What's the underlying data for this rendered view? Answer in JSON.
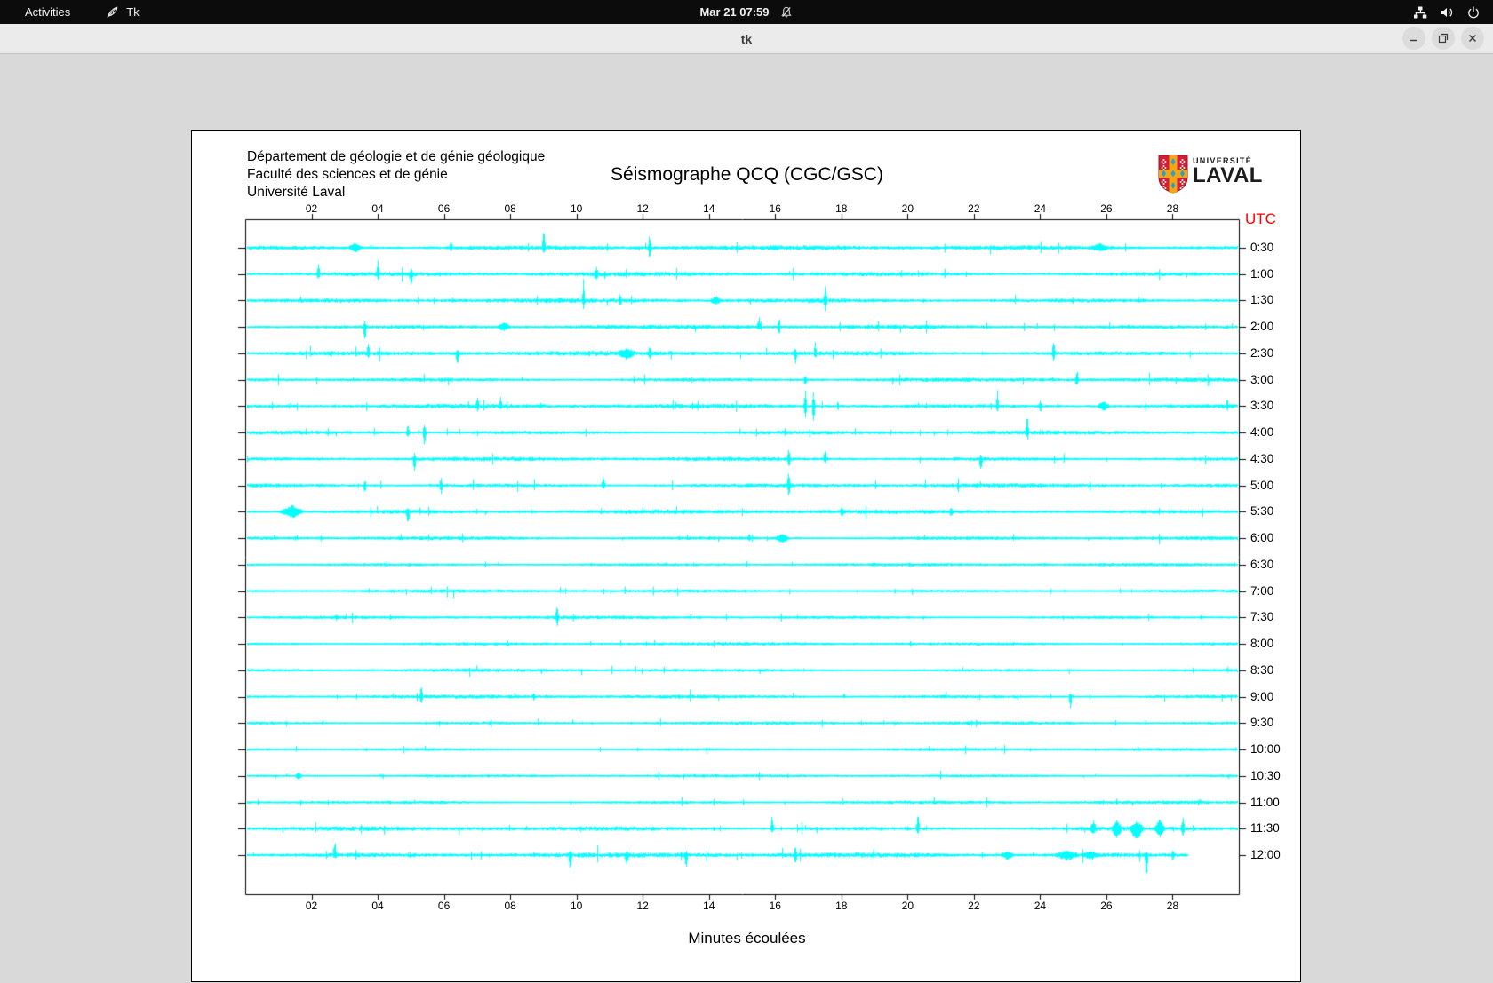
{
  "top_bar": {
    "activities_label": "Activities",
    "app_name": "Tk",
    "clock": "Mar 21 07:59"
  },
  "window": {
    "title": "tk"
  },
  "header": {
    "lines": [
      "Département de géologie et de génie géologique",
      "Faculté des sciences et de génie",
      "Université Laval"
    ],
    "title": "Séismographe QCQ (CGC/GSC)"
  },
  "logo": {
    "small_text": "UNIVERSITÉ",
    "big_text": "LAVAL"
  },
  "plot": {
    "utc_label": "UTC",
    "xlabel": "Minutes écoulées"
  },
  "chart_data": {
    "type": "line",
    "title": "Séismographe QCQ (CGC/GSC)",
    "xlabel": "Minutes écoulées",
    "ylabel_right": "UTC",
    "x_range_minutes": [
      0,
      30
    ],
    "x_ticks": [
      "02",
      "04",
      "06",
      "08",
      "10",
      "12",
      "14",
      "16",
      "18",
      "20",
      "22",
      "24",
      "26",
      "28"
    ],
    "trace_color": "#00ffff",
    "utc_color": "#ff0000",
    "grid": false,
    "traces": [
      {
        "label": "0:30",
        "noise": 1.4,
        "end": 30,
        "events": [
          [
            3.3,
            5,
            5,
            4
          ],
          [
            6.2,
            7,
            4,
            1
          ],
          [
            9.0,
            21,
            5,
            1
          ],
          [
            12.2,
            17,
            15,
            1
          ],
          [
            25.8,
            4,
            4,
            5
          ]
        ]
      },
      {
        "label": "1:00",
        "noise": 1.3,
        "end": 30,
        "events": [
          [
            2.2,
            13,
            5,
            1
          ],
          [
            4.0,
            15,
            8,
            1
          ],
          [
            5.0,
            6,
            17,
            1
          ],
          [
            10.6,
            7,
            6,
            1
          ]
        ]
      },
      {
        "label": "1:30",
        "noise": 1.3,
        "end": 30,
        "events": [
          [
            10.2,
            19,
            5,
            1
          ],
          [
            11.3,
            7,
            5,
            1
          ],
          [
            14.2,
            4,
            4,
            3
          ],
          [
            17.5,
            17,
            13,
            1
          ]
        ]
      },
      {
        "label": "2:00",
        "noise": 1.3,
        "end": 30,
        "events": [
          [
            3.6,
            6,
            22,
            1
          ],
          [
            7.8,
            5,
            4,
            4
          ],
          [
            15.5,
            12,
            4,
            1
          ],
          [
            16.1,
            8,
            6,
            1
          ]
        ]
      },
      {
        "label": "2:30",
        "noise": 1.4,
        "end": 30,
        "events": [
          [
            3.7,
            14,
            4,
            1
          ],
          [
            6.4,
            4,
            21,
            1
          ],
          [
            11.5,
            5,
            5,
            5
          ],
          [
            12.2,
            8,
            6,
            1
          ],
          [
            16.6,
            5,
            14,
            1
          ],
          [
            17.2,
            12,
            5,
            1
          ],
          [
            24.4,
            19,
            9,
            1
          ]
        ]
      },
      {
        "label": "3:00",
        "noise": 1.2,
        "end": 30,
        "events": [
          [
            16.9,
            6,
            6,
            1
          ],
          [
            25.1,
            13,
            10,
            1
          ]
        ]
      },
      {
        "label": "3:30",
        "noise": 1.3,
        "end": 30,
        "events": [
          [
            7.0,
            13,
            5,
            1
          ],
          [
            7.7,
            10,
            4,
            1
          ],
          [
            16.9,
            20,
            18,
            1
          ],
          [
            17.15,
            16,
            20,
            1
          ],
          [
            22.7,
            17,
            6,
            1
          ],
          [
            24.0,
            6,
            6,
            1
          ],
          [
            25.9,
            5,
            5,
            4
          ]
        ]
      },
      {
        "label": "4:00",
        "noise": 1.2,
        "end": 30,
        "events": [
          [
            4.9,
            9,
            6,
            1
          ],
          [
            5.4,
            15,
            16,
            1
          ],
          [
            23.6,
            21,
            6,
            1
          ]
        ]
      },
      {
        "label": "4:30",
        "noise": 1.2,
        "end": 30,
        "events": [
          [
            5.1,
            5,
            16,
            1
          ],
          [
            16.4,
            10,
            12,
            1
          ],
          [
            17.5,
            13,
            4,
            1
          ],
          [
            22.2,
            5,
            21,
            1
          ]
        ]
      },
      {
        "label": "5:00",
        "noise": 1.2,
        "end": 30,
        "events": [
          [
            3.6,
            5,
            12,
            1
          ],
          [
            5.9,
            10,
            10,
            1
          ],
          [
            10.8,
            13,
            4,
            1
          ],
          [
            16.4,
            15,
            16,
            1
          ]
        ]
      },
      {
        "label": "5:30",
        "noise": 1.3,
        "end": 30,
        "events": [
          [
            1.4,
            7,
            7,
            7
          ],
          [
            4.9,
            4,
            21,
            1
          ],
          [
            18.0,
            6,
            5,
            1
          ],
          [
            21.3,
            4,
            4,
            1
          ]
        ]
      },
      {
        "label": "6:00",
        "noise": 1.1,
        "end": 30,
        "events": [
          [
            15.2,
            5,
            4,
            1
          ],
          [
            16.2,
            5,
            5,
            4
          ]
        ]
      },
      {
        "label": "6:30",
        "noise": 1.0,
        "end": 30,
        "events": []
      },
      {
        "label": "7:00",
        "noise": 1.0,
        "end": 30,
        "events": []
      },
      {
        "label": "7:30",
        "noise": 1.0,
        "end": 30,
        "events": [
          [
            9.4,
            15,
            12,
            1
          ]
        ]
      },
      {
        "label": "8:00",
        "noise": 1.0,
        "end": 30,
        "events": []
      },
      {
        "label": "8:30",
        "noise": 1.0,
        "end": 30,
        "events": []
      },
      {
        "label": "9:00",
        "noise": 1.1,
        "end": 30,
        "events": [
          [
            5.3,
            13,
            10,
            1
          ],
          [
            8.7,
            5,
            4,
            1
          ],
          [
            24.9,
            4,
            18,
            1
          ]
        ]
      },
      {
        "label": "9:30",
        "noise": 1.0,
        "end": 30,
        "events": []
      },
      {
        "label": "10:00",
        "noise": 0.9,
        "end": 30,
        "events": []
      },
      {
        "label": "10:30",
        "noise": 0.9,
        "end": 30,
        "events": [
          [
            1.6,
            4,
            4,
            2
          ]
        ]
      },
      {
        "label": "11:00",
        "noise": 1.0,
        "end": 30,
        "events": []
      },
      {
        "label": "11:30",
        "noise": 1.3,
        "end": 30,
        "events": [
          [
            15.9,
            17,
            5,
            1
          ],
          [
            20.3,
            19,
            6,
            1
          ],
          [
            25.6,
            8,
            6,
            2
          ],
          [
            26.3,
            10,
            12,
            3
          ],
          [
            26.9,
            8,
            14,
            4
          ],
          [
            27.6,
            12,
            10,
            3
          ],
          [
            28.3,
            14,
            8,
            1
          ]
        ]
      },
      {
        "label": "12:00",
        "noise": 1.4,
        "end": 28.5,
        "events": [
          [
            2.7,
            18,
            4,
            1
          ],
          [
            9.8,
            6,
            22,
            1
          ],
          [
            11.5,
            4,
            14,
            1
          ],
          [
            13.3,
            4,
            18,
            1
          ],
          [
            16.6,
            10,
            12,
            1
          ],
          [
            23.0,
            4,
            4,
            4
          ],
          [
            24.8,
            5,
            5,
            7
          ],
          [
            25.5,
            4,
            4,
            5
          ],
          [
            27.2,
            2,
            34,
            1
          ],
          [
            28.0,
            6,
            6,
            1
          ]
        ]
      }
    ]
  }
}
